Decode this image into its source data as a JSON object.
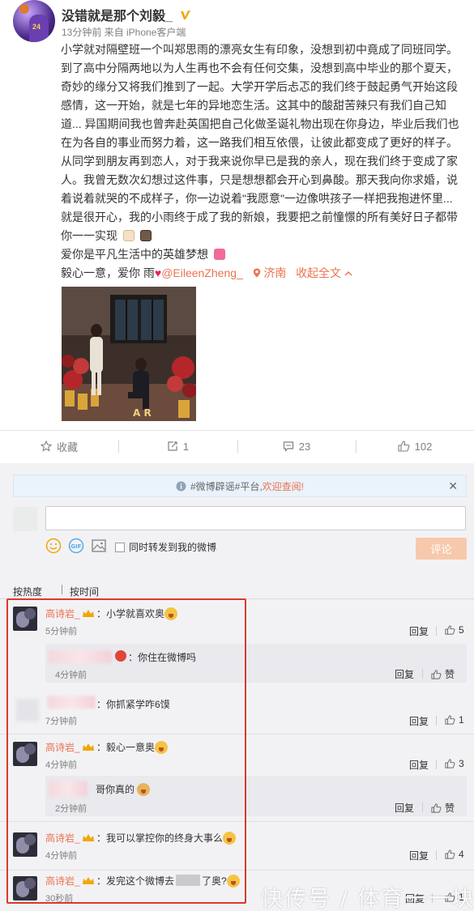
{
  "post": {
    "username": "没错就是那个刘毅_",
    "meta": "13分钟前 来自 iPhone客户端",
    "lines": [
      "小学就对隔壁班一个叫郑思雨的漂亮女生有印象，没想到初中竟成了同班同学。",
      "到了高中分隔两地以为人生再也不会有任何交集，没想到高中毕业的那个夏天，",
      "奇妙的缘分又将我们推到了一起。大学开学后忐忑的我们终于鼓起勇气开始这段",
      "感情，这一开始，就是七年的异地恋生活。这其中的酸甜苦辣只有我们自己知",
      "道... 异国期间我也曾奔赴英国把自己化做圣诞礼物出现在你身边，毕业后我们也",
      "在为各自的事业而努力着，这一路我们相互依偎，让彼此都变成了更好的样子。",
      "从同学到朋友再到恋人，对于我来说你早已是我的亲人，现在我们终于变成了家",
      "人。我曾无数次幻想过这件事，只是想想都会开心到鼻酸。那天我向你求婚，说",
      "着说着就哭的不成样子，你一边说着\"我愿意\"一边像哄孩子一样把我抱进怀里...",
      "就是很开心，我的小雨终于成了我的新娘，我要把之前憧憬的所有美好日子都带",
      "你一一实现"
    ],
    "line_love": "爱你是平凡生活中的英雄梦想",
    "line_sign_prefix": "毅心一意，爱你 雨",
    "mention": "@EileenZheng_",
    "location": "济南",
    "collapse": "收起全文"
  },
  "actions": {
    "favorite": "收藏",
    "repost_count": "1",
    "comment_count": "23",
    "like_count": "102"
  },
  "comments_panel": {
    "notice_prefix": "#微博辟谣#平台,",
    "notice_link": "欢迎查阅!",
    "repost_label": "同时转发到我的微博",
    "submit_label": "评论",
    "sort_hot": "按热度",
    "sort_time": "按时间"
  },
  "comments": [
    {
      "name": "高诗岩_",
      "text": "：小学就喜欢奥",
      "time": "5分钟前",
      "reply": "回复",
      "likes": "5"
    },
    {
      "text": "：你住在微博吗",
      "time": "4分钟前",
      "reply": "回复",
      "likes": "赞"
    },
    {
      "text": "：你抓紧学咋6馍",
      "time": "7分钟前",
      "reply": "回复",
      "likes": "1"
    },
    {
      "name": "高诗岩_",
      "text": "：毅心一意奥",
      "time": "4分钟前",
      "reply": "回复",
      "likes": "3"
    },
    {
      "text": "哥你真的",
      "time": "2分钟前",
      "reply": "回复",
      "likes": "赞"
    },
    {
      "name": "高诗岩_",
      "text": "：我可以掌控你的终身大事么",
      "time": "4分钟前",
      "reply": "回复",
      "likes": "4"
    },
    {
      "name": "高诗岩_",
      "text": "：发完这个微博去",
      "text_suffix": "了奥?",
      "time": "30秒前",
      "reply": "回复",
      "likes": "1"
    }
  ],
  "watermark": "快传号 / 体育一一块",
  "colors": {
    "accent": "#eb7350",
    "highlight_border": "#d93a2b",
    "link": "#eb7350"
  }
}
